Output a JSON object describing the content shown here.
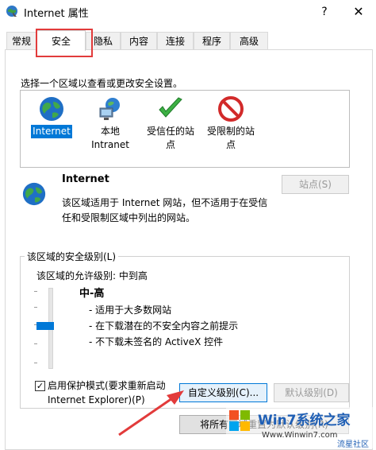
{
  "window": {
    "title": "Internet 属性",
    "help_label": "?",
    "close_label": "✕"
  },
  "tabs": [
    "常规",
    "安全",
    "隐私",
    "内容",
    "连接",
    "程序",
    "高级"
  ],
  "instruction": "选择一个区域以查看或更改安全设置。",
  "zones": [
    {
      "line1": "Internet",
      "line2": "",
      "icon": "globe-icon"
    },
    {
      "line1": "本地",
      "line2": "Intranet",
      "icon": "network-icon"
    },
    {
      "line1": "受信任的站",
      "line2": "点",
      "icon": "check-icon"
    },
    {
      "line1": "受限制的站",
      "line2": "点",
      "icon": "restricted-icon"
    }
  ],
  "zone_info": {
    "title": "Internet",
    "description": "该区域适用于 Internet 网站，但不适用于在受信任和受限制区域中列出的网站。",
    "sites_button": "站点(S)"
  },
  "security_level": {
    "group_label": "该区域的安全级别(L)",
    "allowed_label": "该区域的允许级别: 中到高",
    "level_name": "中-高",
    "bullets": [
      "- 适用于大多数网站",
      "- 在下载潜在的不安全内容之前提示",
      "- 不下载未签名的 ActiveX 控件"
    ],
    "protected_mode_line1": "启用保护模式(要求重新启动",
    "protected_mode_line2": "Internet Explorer)(P)",
    "protected_mode_checked": "✓",
    "custom_button": "自定义级别(C)...",
    "default_button": "默认级别(D)"
  },
  "reset_button": "将所有区域重置为默认级别(R)",
  "watermark": {
    "brand": "Win7系统之家",
    "url": "Www.Winwin7.com",
    "caption": "流星社区"
  },
  "colors": {
    "accent": "#0078d7",
    "highlight": "#e23b3b"
  }
}
